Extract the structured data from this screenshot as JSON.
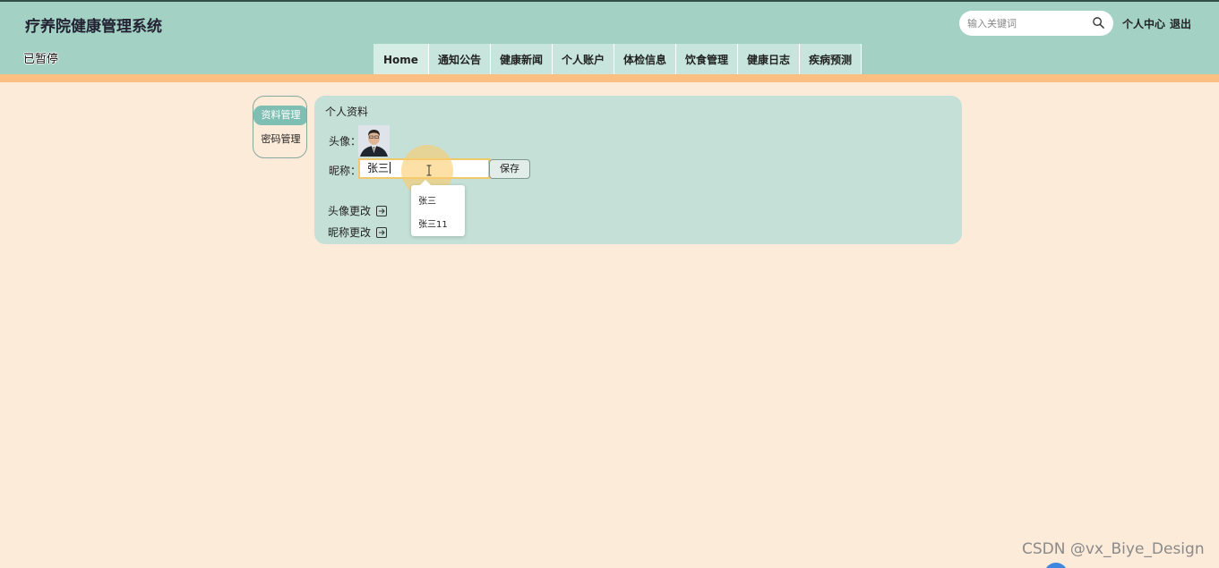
{
  "header": {
    "site_title": "疗养院健康管理系统",
    "status_text": "已暂停",
    "search_placeholder": "输入关键词",
    "personal_center": "个人中心",
    "logout": "退出"
  },
  "nav": {
    "items": [
      "Home",
      "通知公告",
      "健康新闻",
      "个人账户",
      "体检信息",
      "饮食管理",
      "健康日志",
      "疾病预测"
    ]
  },
  "sidebar": {
    "items": [
      {
        "label": "资料管理",
        "active": true
      },
      {
        "label": "密码管理",
        "active": false
      }
    ]
  },
  "profile": {
    "title": "个人资料",
    "avatar_label": "头像：",
    "nickname_label": "昵称：",
    "nickname_value": "张三",
    "save_label": "保存",
    "change_avatar": "头像更改",
    "change_nickname": "昵称更改"
  },
  "autocomplete": {
    "options": [
      "张三",
      "张三11"
    ]
  },
  "watermark": "CSDN @vx_Biye_Design",
  "colors": {
    "header_bg": "#a3d1c3",
    "accent_orange": "#fbbf84",
    "page_bg": "#fdebd9",
    "panel_bg": "#c5e0d7"
  }
}
